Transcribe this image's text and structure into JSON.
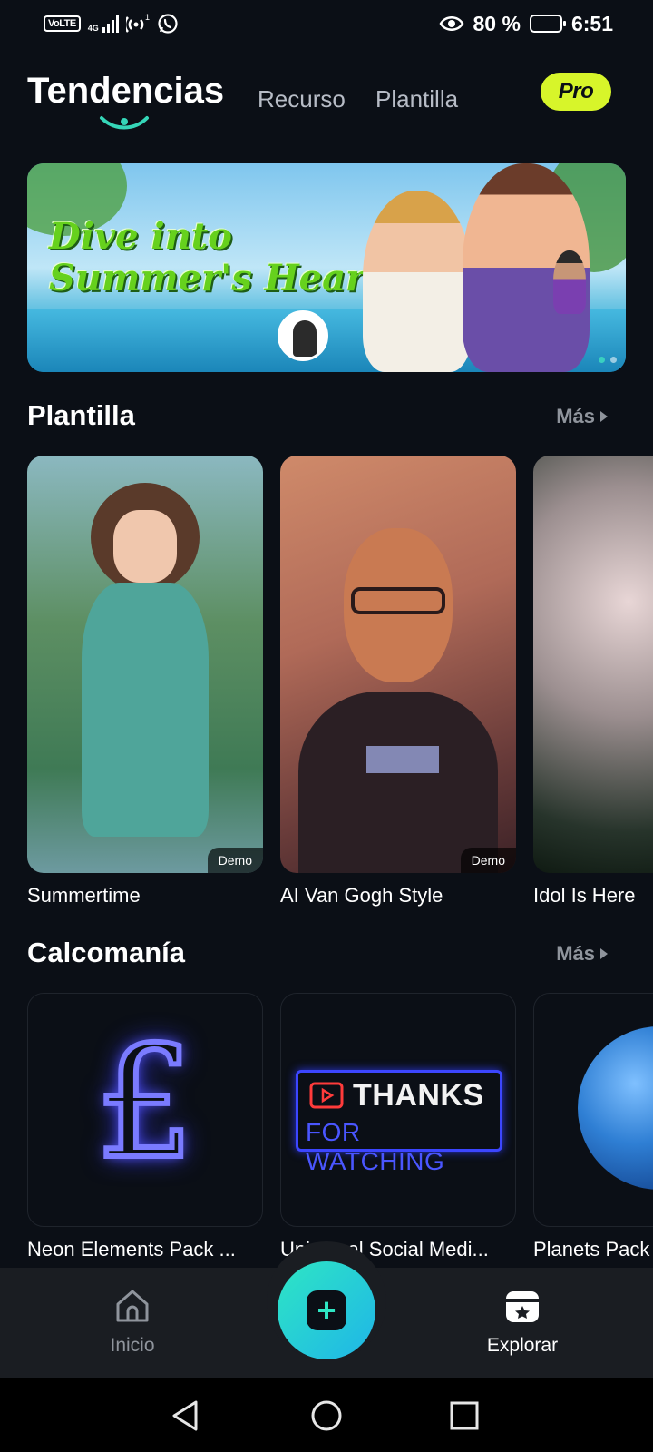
{
  "status_bar": {
    "volte": "VoLTE",
    "network": "4G",
    "battery": "80 %",
    "battery_level": 0.8,
    "time": "6:51"
  },
  "header": {
    "tabs": [
      {
        "label": "Tendencias",
        "active": true
      },
      {
        "label": "Recurso",
        "active": false
      },
      {
        "label": "Plantilla",
        "active": false
      }
    ],
    "pro_badge": "Pro"
  },
  "banner": {
    "title_line1": "Dive into",
    "title_line2": "Summer's Heart",
    "page_count": 2,
    "active_page": 0
  },
  "templates_section": {
    "title": "Plantilla",
    "more_label": "Más",
    "items": [
      {
        "label": "Summertime",
        "badge": "Demo"
      },
      {
        "label": "AI Van Gogh Style",
        "badge": "Demo"
      },
      {
        "label": "Idol Is Here",
        "badge": ""
      }
    ]
  },
  "stickers_section": {
    "title": "Calcomanía",
    "more_label": "Más",
    "items": [
      {
        "label": "Neon Elements Pack ...",
        "art": "£"
      },
      {
        "label": "Universal Social Medi...",
        "art_line1": "THANKS",
        "art_line2": "FOR WATCHING"
      },
      {
        "label": "Planets Pack"
      }
    ]
  },
  "bottom_nav": {
    "home_label": "Inicio",
    "explore_label": "Explorar",
    "add_icon": "plus-icon",
    "colors": {
      "fab_start": "#2ee6c4",
      "fab_end": "#1fb5e8",
      "pro": "#d7f52a"
    }
  }
}
